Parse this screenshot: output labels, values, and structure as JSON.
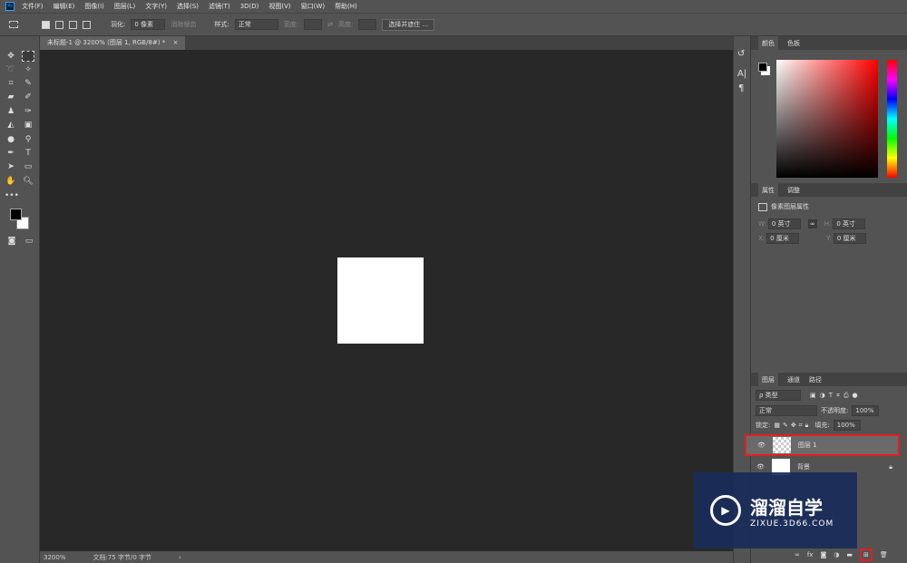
{
  "menu": {
    "logo": "Ps",
    "items": [
      "文件(F)",
      "编辑(E)",
      "图像(I)",
      "图层(L)",
      "文字(Y)",
      "选择(S)",
      "滤镜(T)",
      "3D(D)",
      "视图(V)",
      "窗口(W)",
      "帮助(H)"
    ]
  },
  "options": {
    "feather_label": "羽化:",
    "feather_value": "0 像素",
    "antialias": "消除锯齿",
    "style_label": "样式:",
    "style_value": "正常",
    "width_label": "宽度:",
    "height_label": "高度:",
    "select_mask": "选择并遮住 ..."
  },
  "document": {
    "tab_title": "未标题-1 @ 3200% (图层 1, RGB/8#) *",
    "close": "×"
  },
  "status": {
    "zoom": "3200%",
    "doc_info": "文档:75 字节/0 字节",
    "arrow": "›"
  },
  "color_panel": {
    "tabs": [
      "颜色",
      "色板"
    ]
  },
  "properties_panel": {
    "tabs": [
      "属性",
      "调整"
    ],
    "title": "像素图层属性",
    "w_label": "W:",
    "w_value": "0 英寸",
    "h_label": "H:",
    "h_value": "0 英寸",
    "x_label": "X:",
    "x_value": "0 厘米",
    "y_label": "Y:",
    "y_value": "0 厘米"
  },
  "layers_panel": {
    "tabs": [
      "图层",
      "通道",
      "路径"
    ],
    "filter": "ρ 类型",
    "blend_mode": "正常",
    "opacity_label": "不透明度:",
    "opacity_value": "100%",
    "lock_label": "锁定:",
    "fill_label": "填充:",
    "fill_value": "100%",
    "layers": [
      {
        "name": "图层 1",
        "selected": true
      },
      {
        "name": "背景",
        "locked": true
      }
    ]
  },
  "watermark": {
    "title": "溜溜自学",
    "url": "ZIXUE.3D66.COM"
  },
  "colors": {
    "highlight": "#e02020",
    "canvas": "#282828",
    "ui": "#535353"
  }
}
